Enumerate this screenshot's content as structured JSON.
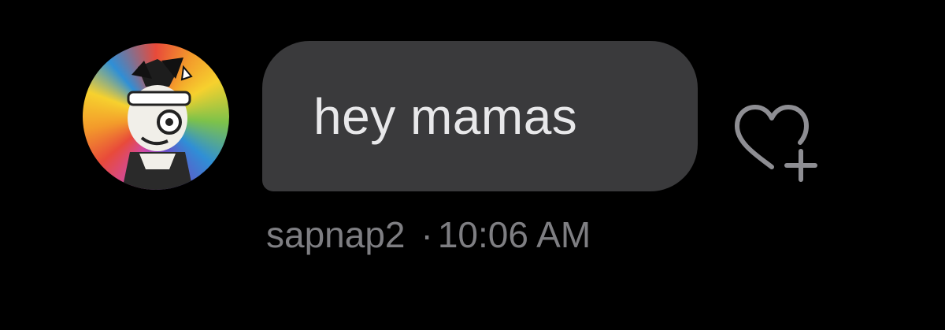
{
  "message": {
    "text": "hey mamas",
    "sender": "sapnap2",
    "separator": "·",
    "time": "10:06 AM"
  },
  "actions": {
    "like_icon": "heart-plus-icon"
  },
  "avatar": {
    "icon": "avatar"
  },
  "colors": {
    "background": "#000000",
    "bubble": "#3a3a3c",
    "bubble_text": "#e8e8ea",
    "meta_text": "#7e7e82",
    "icon_stroke": "#8e8e93"
  }
}
